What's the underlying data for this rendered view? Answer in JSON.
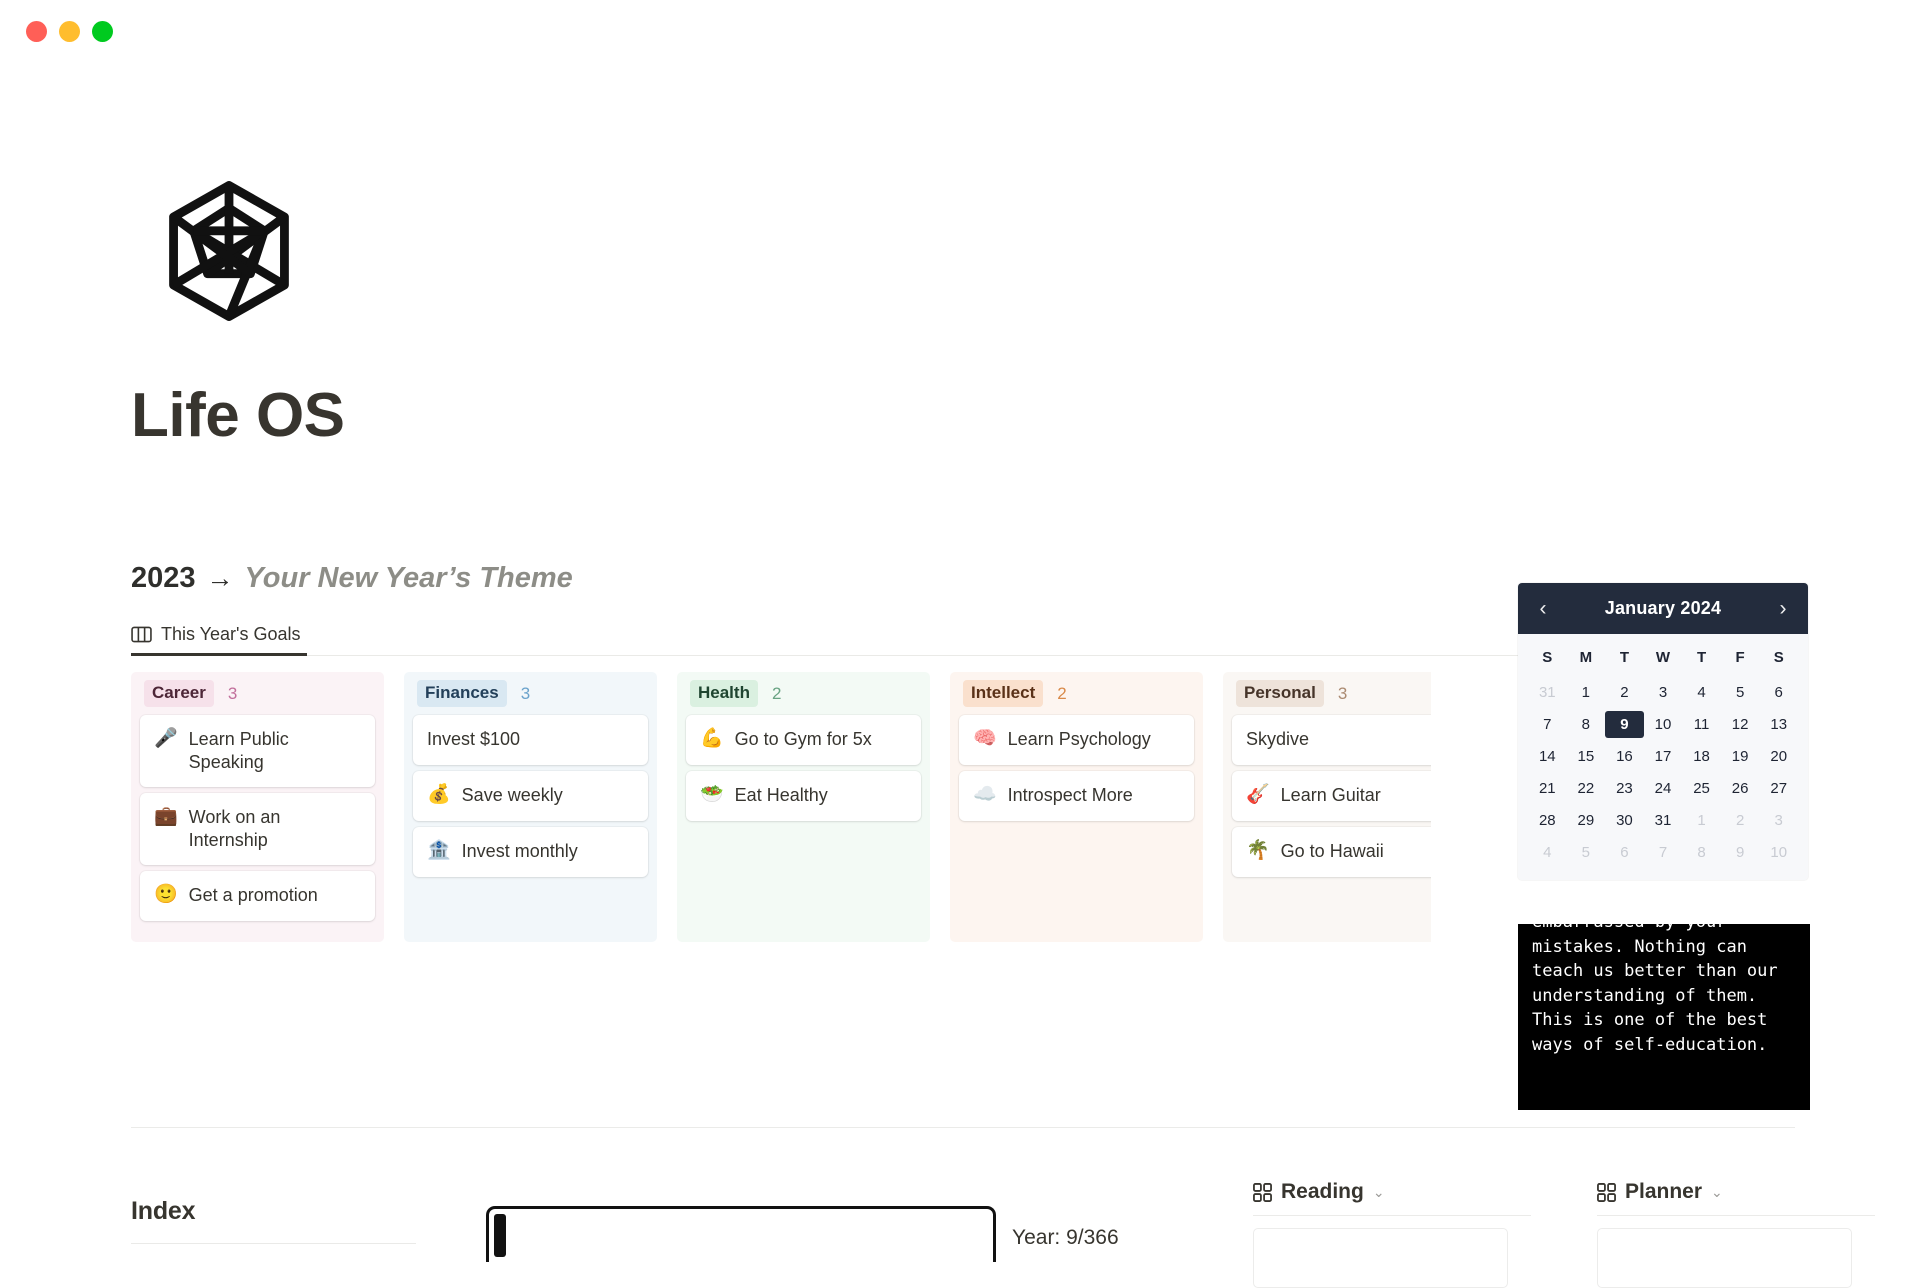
{
  "window": {
    "controls": [
      {
        "name": "close",
        "color": "#ff5f57"
      },
      {
        "name": "minimize",
        "color": "#ffbd2e"
      },
      {
        "name": "maximize",
        "color": "#00ca1f"
      }
    ]
  },
  "header": {
    "logo_alt": "Life OS cube logo",
    "title": "Life OS"
  },
  "theme": {
    "year": "2023",
    "arrow": "→",
    "text": "Your New Year’s Theme"
  },
  "tabs": [
    {
      "label": "This Year's Goals",
      "icon": "board-columns-icon",
      "active": true
    }
  ],
  "board": {
    "columns": [
      {
        "key": "career",
        "label": "Career",
        "count": "3",
        "chip_bg": "#f6e1ea",
        "chip_fg": "#4d2637",
        "tint": "#fbf3f6",
        "cards": [
          {
            "emoji": "🎤",
            "text": "Learn Public Speaking"
          },
          {
            "emoji": "💼",
            "text": "Work on an Internship"
          },
          {
            "emoji": "🙂",
            "text": "Get a promotion"
          }
        ]
      },
      {
        "key": "finances",
        "label": "Finances",
        "count": "3",
        "chip_bg": "#d9e8f2",
        "chip_fg": "#23405a",
        "tint": "#f2f7fa",
        "cards": [
          {
            "emoji": "",
            "text": "Invest $100"
          },
          {
            "emoji": "💰",
            "text": "Save weekly"
          },
          {
            "emoji": "🏦",
            "text": "Invest monthly"
          }
        ]
      },
      {
        "key": "health",
        "label": "Health",
        "count": "2",
        "chip_bg": "#daf0e0",
        "chip_fg": "#1f4530",
        "tint": "#f3faf5",
        "cards": [
          {
            "emoji": "💪",
            "text": "Go to Gym for 5x"
          },
          {
            "emoji": "🥗",
            "text": "Eat Healthy"
          }
        ]
      },
      {
        "key": "intellect",
        "label": "Intellect",
        "count": "2",
        "chip_bg": "#fae0cd",
        "chip_fg": "#5a3118",
        "tint": "#fdf5f0",
        "cards": [
          {
            "emoji": "🧠",
            "text": "Learn Psychology"
          },
          {
            "emoji": "☁️",
            "text": "Introspect More"
          }
        ]
      },
      {
        "key": "personal",
        "label": "Personal",
        "count": "3",
        "chip_bg": "#eee3da",
        "chip_fg": "#463429",
        "tint": "#faf7f4",
        "cards": [
          {
            "emoji": "",
            "text": "Skydive"
          },
          {
            "emoji": "🎸",
            "text": "Learn Guitar"
          },
          {
            "emoji": "🌴",
            "text": "Go to Hawaii"
          }
        ]
      }
    ]
  },
  "calendar": {
    "title": "January 2024",
    "prev_icon": "chevron-left-icon",
    "next_icon": "chevron-right-icon",
    "prev_glyph": "‹",
    "next_glyph": "›",
    "dow": [
      "S",
      "M",
      "T",
      "W",
      "T",
      "F",
      "S"
    ],
    "today": 9,
    "header_bg": "#232c3d",
    "weeks": [
      [
        {
          "d": "31",
          "muted": true
        },
        {
          "d": "1"
        },
        {
          "d": "2"
        },
        {
          "d": "3"
        },
        {
          "d": "4"
        },
        {
          "d": "5"
        },
        {
          "d": "6"
        }
      ],
      [
        {
          "d": "7"
        },
        {
          "d": "8"
        },
        {
          "d": "9",
          "today": true
        },
        {
          "d": "10"
        },
        {
          "d": "11"
        },
        {
          "d": "12"
        },
        {
          "d": "13"
        }
      ],
      [
        {
          "d": "14"
        },
        {
          "d": "15"
        },
        {
          "d": "16"
        },
        {
          "d": "17"
        },
        {
          "d": "18"
        },
        {
          "d": "19"
        },
        {
          "d": "20"
        }
      ],
      [
        {
          "d": "21"
        },
        {
          "d": "22"
        },
        {
          "d": "23"
        },
        {
          "d": "24"
        },
        {
          "d": "25"
        },
        {
          "d": "26"
        },
        {
          "d": "27"
        }
      ],
      [
        {
          "d": "28"
        },
        {
          "d": "29"
        },
        {
          "d": "30"
        },
        {
          "d": "31"
        },
        {
          "d": "1",
          "muted": true
        },
        {
          "d": "2",
          "muted": true
        },
        {
          "d": "3",
          "muted": true
        }
      ],
      [
        {
          "d": "4",
          "muted": true
        },
        {
          "d": "5",
          "muted": true
        },
        {
          "d": "6",
          "muted": true
        },
        {
          "d": "7",
          "muted": true
        },
        {
          "d": "8",
          "muted": true
        },
        {
          "d": "9",
          "muted": true
        },
        {
          "d": "10",
          "muted": true
        }
      ]
    ]
  },
  "quote": {
    "text": "embarrassed by your mistakes. Nothing can teach us better than our understanding of them. This is one of the best ways of self-education.",
    "bg": "#000000",
    "fg": "#ffffff"
  },
  "index": {
    "title": "Index"
  },
  "year_progress": {
    "label": "Year: 9/366",
    "percent": 2.5
  },
  "databases": [
    {
      "key": "reading",
      "title": "Reading",
      "icon": "grid-icon",
      "caret": "⌄"
    },
    {
      "key": "planner",
      "title": "Planner",
      "icon": "grid-icon",
      "caret": "⌄"
    }
  ]
}
